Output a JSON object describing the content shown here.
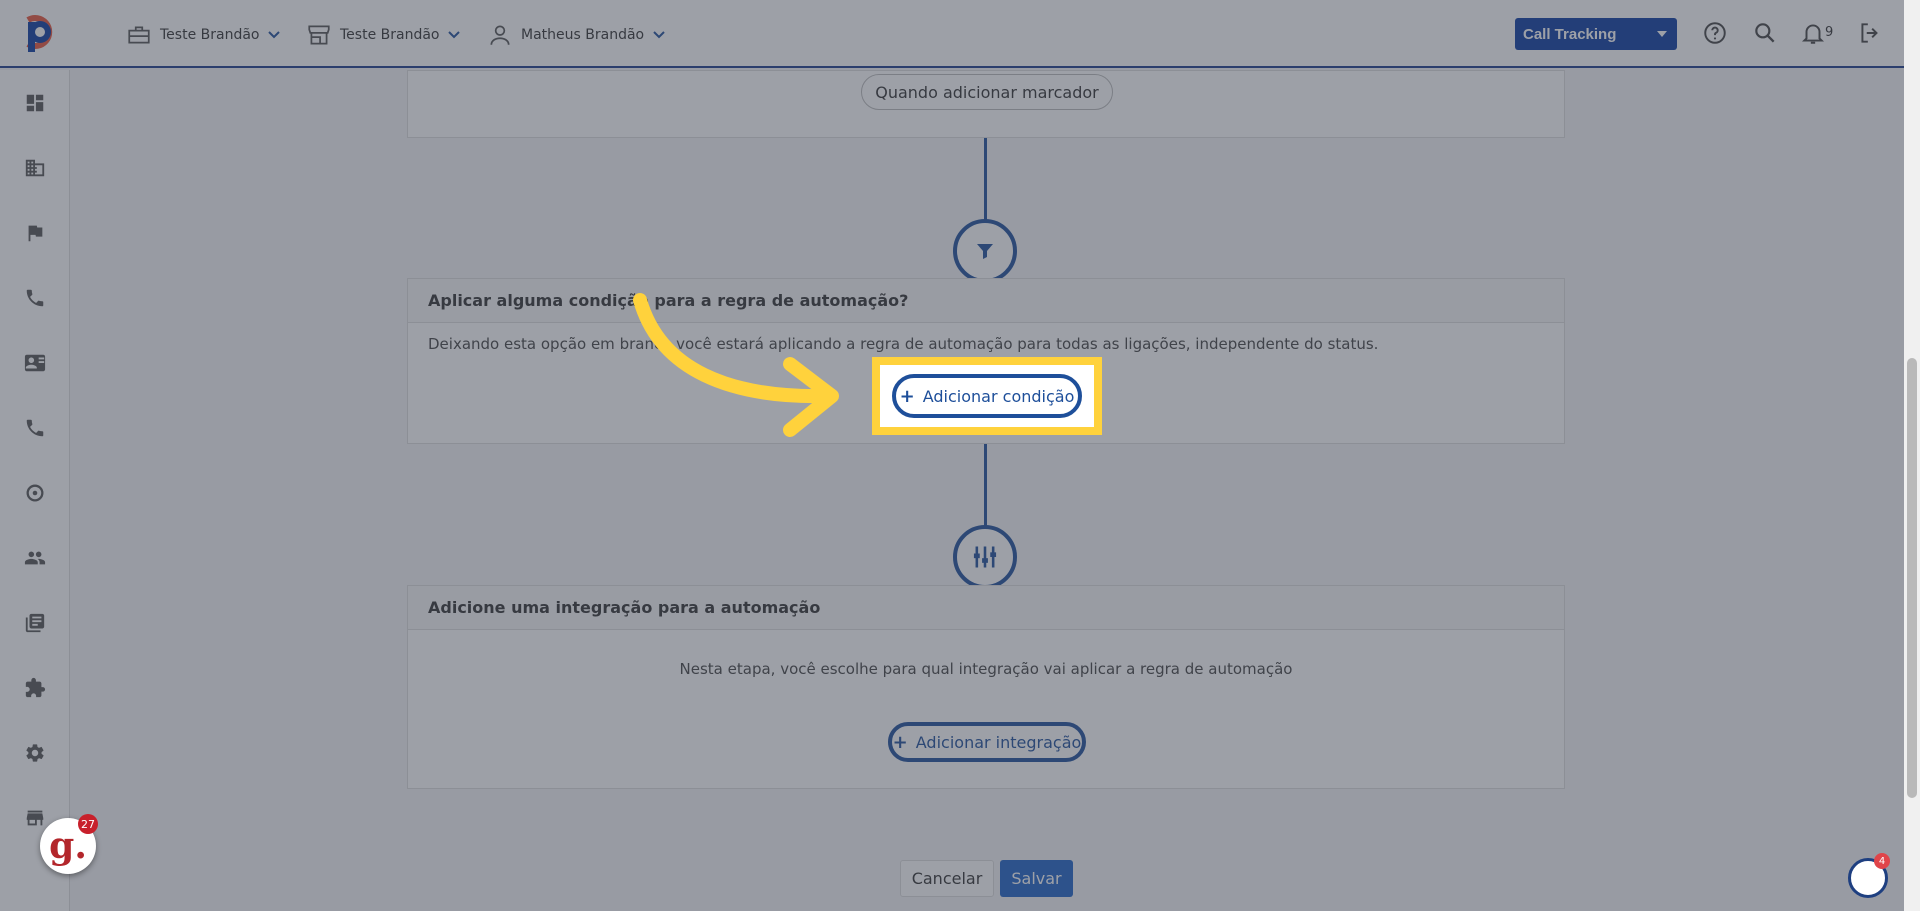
{
  "topbar": {
    "company": "Teste Brandão",
    "store": "Teste Brandão",
    "user": "Matheus Brandão",
    "product_select": "Call Tracking",
    "notifications_count": "9"
  },
  "sidebar": {
    "icons": [
      "dashboard-icon",
      "building-icon",
      "flag-icon",
      "phone-icon",
      "contact-card-icon",
      "phone-icon",
      "360-icon",
      "people-icon",
      "library-icon",
      "puzzle-icon",
      "gear-icon",
      "store-icon"
    ]
  },
  "trigger_card": {
    "trigger_label": "Quando adicionar marcador"
  },
  "condition_card": {
    "title": "Aplicar alguma condição para a regra de automação?",
    "description": "Deixando esta opção em branco você estará aplicando a regra de automação para todas as ligações, independente do status.",
    "add_button": "Adicionar condição"
  },
  "integration_card": {
    "title": "Adicione uma integração para a automação",
    "description": "Nesta etapa, você escolhe para qual integração vai aplicar a regra de automação",
    "add_button": "Adicionar integração"
  },
  "footer": {
    "cancel": "Cancelar",
    "save": "Salvar"
  },
  "widgets": {
    "g_letter": "g.",
    "g_count": "27",
    "help_count": "4"
  },
  "colors": {
    "primary": "#1e4f9a",
    "highlight": "#ffd23c",
    "save_button": "#1e63c6"
  }
}
